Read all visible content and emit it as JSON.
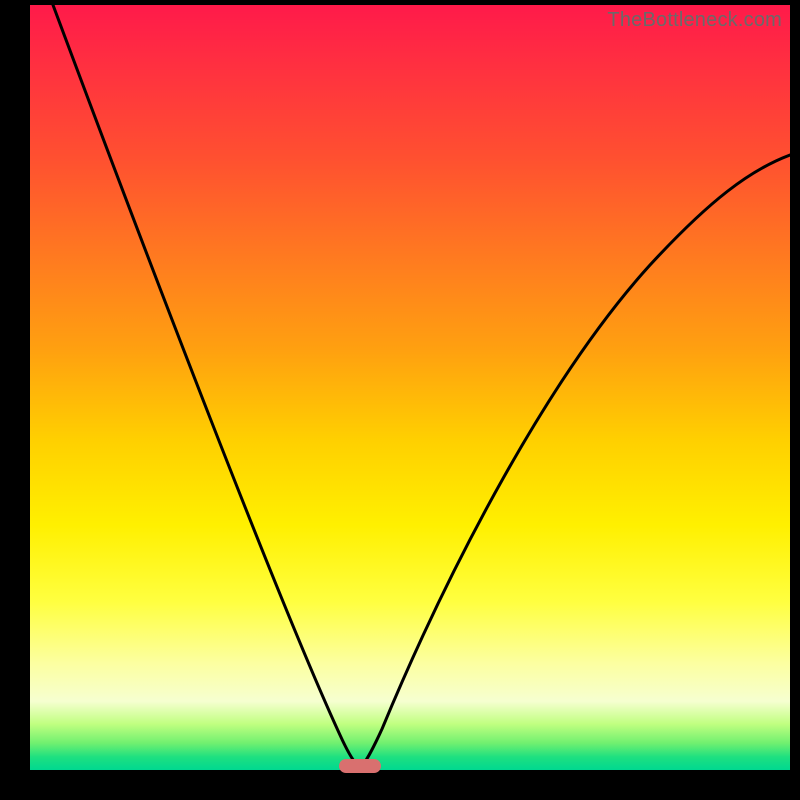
{
  "watermark": "TheBottleneck.com",
  "chart_data": {
    "type": "line",
    "title": "",
    "xlabel": "",
    "ylabel": "",
    "xlim": [
      0,
      1
    ],
    "ylim": [
      0,
      1
    ],
    "series": [
      {
        "name": "curve",
        "x": [
          0.03,
          0.09,
          0.15,
          0.21,
          0.27,
          0.33,
          0.39,
          0.415,
          0.43,
          0.44,
          0.47,
          0.51,
          0.56,
          0.62,
          0.68,
          0.74,
          0.8,
          0.86,
          0.92,
          0.98
        ],
        "y": [
          1.0,
          0.82,
          0.66,
          0.51,
          0.37,
          0.23,
          0.09,
          0.025,
          0.0,
          0.005,
          0.08,
          0.19,
          0.32,
          0.44,
          0.54,
          0.62,
          0.69,
          0.74,
          0.78,
          0.8
        ]
      }
    ],
    "gradient_stops": [
      {
        "pos": 0.0,
        "color": "#ff1a4a"
      },
      {
        "pos": 0.5,
        "color": "#ffd000"
      },
      {
        "pos": 0.8,
        "color": "#ffff60"
      },
      {
        "pos": 0.97,
        "color": "#50e878"
      },
      {
        "pos": 1.0,
        "color": "#00d890"
      }
    ],
    "marker": {
      "x": 0.43,
      "y": 0.0,
      "color": "#d9706f"
    }
  }
}
